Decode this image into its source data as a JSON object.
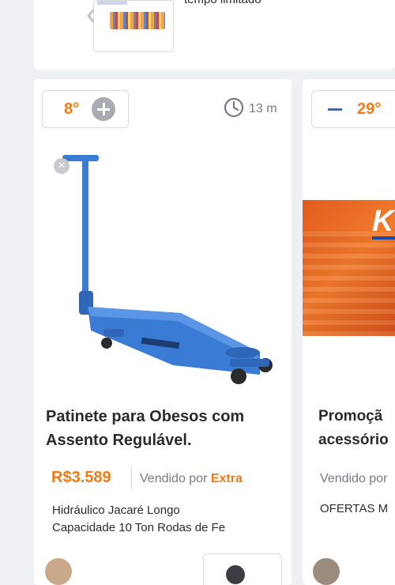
{
  "top_strip": {
    "text": "tempo limitado"
  },
  "card_main": {
    "temperature": "8°",
    "time_ago": "13 m",
    "title_line1": "Patinete para Obesos com",
    "title_line2": "Assento Regulável.",
    "price": "R$3.589",
    "vendor_prefix": "Vendido por",
    "vendor_store": "Extra",
    "description_line1": "Hidráulico Jacaré Longo",
    "description_line2": "Capacidade 10 Ton Rodas de Fe"
  },
  "card_side": {
    "temperature": "29°",
    "logo_text": "K",
    "title_line1": "Promoçã",
    "title_line2": "acessório",
    "vendor_prefix": "Vendido por",
    "description": "OFERTAS M"
  },
  "colors": {
    "accent_orange": "#f27a14",
    "accent_blue": "#2f6cc7",
    "product_blue": "#3a7bd5"
  },
  "icons": {
    "back": "chevron-left-icon",
    "plus": "plus-icon",
    "minus": "minus-icon",
    "clock": "clock-icon",
    "close": "close-icon",
    "comment": "comment-icon"
  }
}
